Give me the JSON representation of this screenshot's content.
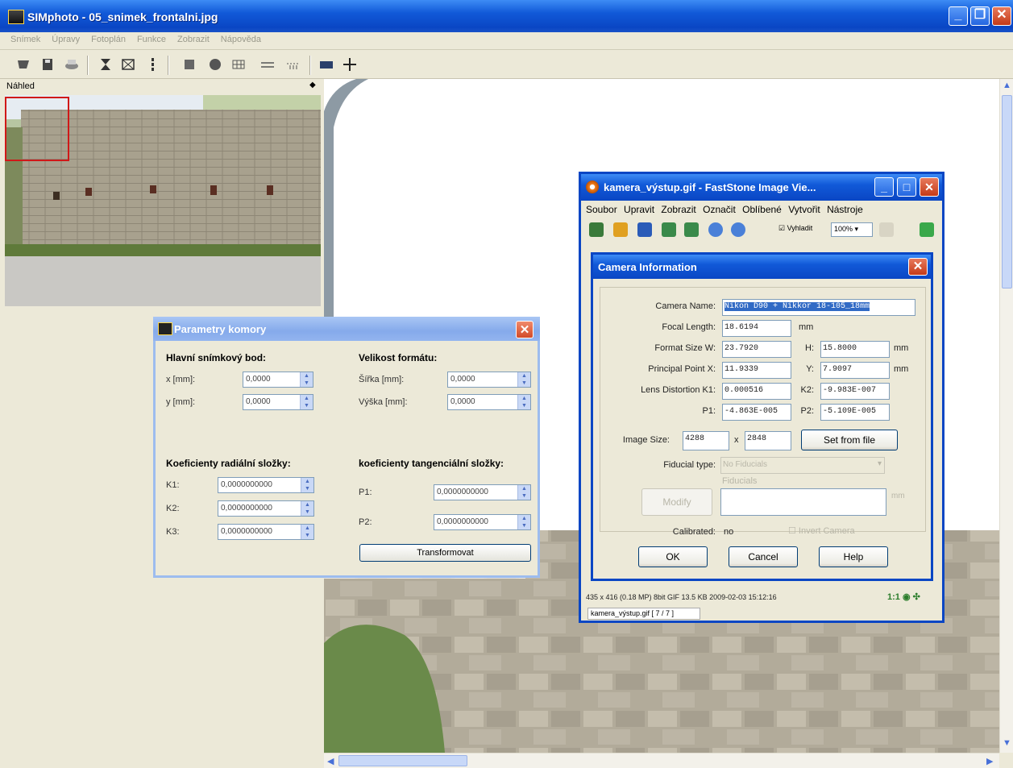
{
  "window": {
    "title": "SIMphoto - 05_snimek_frontalni.jpg"
  },
  "menu": [
    "Snímek",
    "Úpravy",
    "Fotoplán",
    "Funkce",
    "Zobrazit",
    "Nápověda"
  ],
  "preview": {
    "label": "Náhled"
  },
  "param_dialog": {
    "title": "Parametry komory",
    "main_point_heading": "Hlavní snímkový bod:",
    "x_label": "x [mm]:",
    "x_value": "0,0000",
    "y_label": "y [mm]:",
    "y_value": "0,0000",
    "format_heading": "Velikost formátu:",
    "width_label": "Šířka [mm]:",
    "width_value": "0,0000",
    "height_label": "Výška [mm]:",
    "height_value": "0,0000",
    "radial_heading": "Koeficienty radiální složky:",
    "k1_label": "K1:",
    "k1_value": "0,0000000000",
    "k2_label": "K2:",
    "k2_value": "0,0000000000",
    "k3_label": "K3:",
    "k3_value": "0,0000000000",
    "tangential_heading": "koeficienty tangenciální složky:",
    "p1_label": "P1:",
    "p1_value": "0,0000000000",
    "p2_label": "P2:",
    "p2_value": "0,0000000000",
    "transform_button": "Transformovat"
  },
  "fs_window": {
    "title": "kamera_výstup.gif  -  FastStone Image Vie...",
    "menu": [
      "Soubor",
      "Upravit",
      "Zobrazit",
      "Označit",
      "Oblíbené",
      "Vytvořit",
      "Nástroje"
    ],
    "fit_checkbox": "Vyhladit",
    "zoom": "100%",
    "status_line": "435 x 416 (0.18 MP)   8bit GIF   13.5 KB   2009-02-03 15:12:16",
    "status_zoom": "1:1",
    "file_label": "kamera_výstup.gif [ 7 / 7 ]"
  },
  "camera_dialog": {
    "title": "Camera Information",
    "camera_name_label": "Camera Name:",
    "camera_name": "Nikon D90 + Nikkor 18-105_18mm",
    "focal_length_label": "Focal Length:",
    "focal_length": "18.6194",
    "focal_unit": "mm",
    "format_w_label": "Format Size W:",
    "format_w": "23.7920",
    "format_h_label": "H:",
    "format_h": "15.8000",
    "format_unit": "mm",
    "pp_x_label": "Principal Point X:",
    "pp_x": "11.9339",
    "pp_y_label": "Y:",
    "pp_y": "7.9097",
    "pp_unit": "mm",
    "k1_label": "Lens Distortion  K1:",
    "k1": "0.000516",
    "k2_label": "K2:",
    "k2": "-9.983E-007",
    "p1_label": "P1:",
    "p1": "-4.863E-005",
    "p2_label": "P2:",
    "p2": "-5.109E-005",
    "image_size_label": "Image Size:",
    "image_w": "4288",
    "times": "x",
    "image_h": "2848",
    "set_from_file": "Set from file",
    "fiducial_type_label": "Fiducial type:",
    "fiducial_type": "No Fiducials",
    "fiducials_label": "Fiducials",
    "modify_button": "Modify",
    "fiducial_unit": "mm",
    "calibrated_label": "Calibrated:",
    "calibrated_value": "no",
    "invert_label": "Invert Camera",
    "ok": "OK",
    "cancel": "Cancel",
    "help": "Help"
  },
  "colors": {
    "xp_blue": "#0a46c4",
    "inactive_title": "#93b4ef",
    "preview_frame": "#d01818"
  }
}
